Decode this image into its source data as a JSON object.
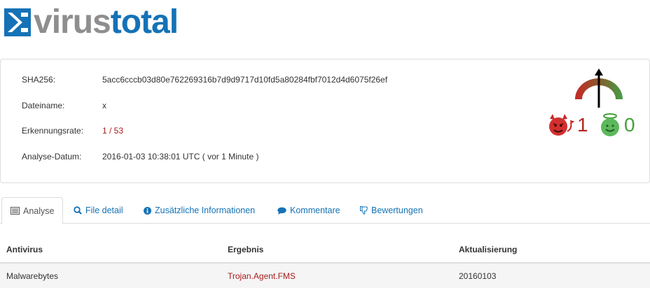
{
  "brand": {
    "part1": "virus",
    "part2": "total",
    "logo_icon": "virustotal-sigma-icon"
  },
  "file_info": {
    "sha256_label": "SHA256:",
    "sha256_value": "5acc6cccb03d80e762269316b7d9d9717d10fd5a80284fbf7012d4d6075f26ef",
    "filename_label": "Dateiname:",
    "filename_value": "x",
    "detection_label": "Erkennungsrate:",
    "detection_value": "1 / 53",
    "analysis_date_label": "Analyse-Datum:",
    "analysis_date_value": "2016-01-03 10:38:01 UTC ( vor 1 Minute )"
  },
  "community_score": {
    "malicious_votes": "1",
    "harmless_votes": "0",
    "malicious_icon": "devil-face-icon",
    "harmless_icon": "angel-face-icon",
    "gauge_icon": "score-gauge-icon"
  },
  "tabs": [
    {
      "label": "Analyse",
      "icon": "list-icon",
      "active": true
    },
    {
      "label": "File detail",
      "icon": "magnifier-icon",
      "active": false
    },
    {
      "label": "Zusätzliche Informationen",
      "icon": "info-icon",
      "active": false
    },
    {
      "label": "Kommentare",
      "icon": "speech-bubble-icon",
      "active": false
    },
    {
      "label": "Bewertungen",
      "icon": "thumbs-down-icon",
      "active": false
    }
  ],
  "table": {
    "columns": [
      "Antivirus",
      "Ergebnis",
      "Aktualisierung"
    ],
    "rows": [
      {
        "antivirus": "Malwarebytes",
        "result": "Trojan.Agent.FMS",
        "updated": "20160103"
      }
    ]
  },
  "colors": {
    "brand_blue": "#1572b6",
    "brand_gray": "#8e8e8e",
    "malicious_red": "#a61c1c",
    "harmless_green": "#46a03c"
  }
}
